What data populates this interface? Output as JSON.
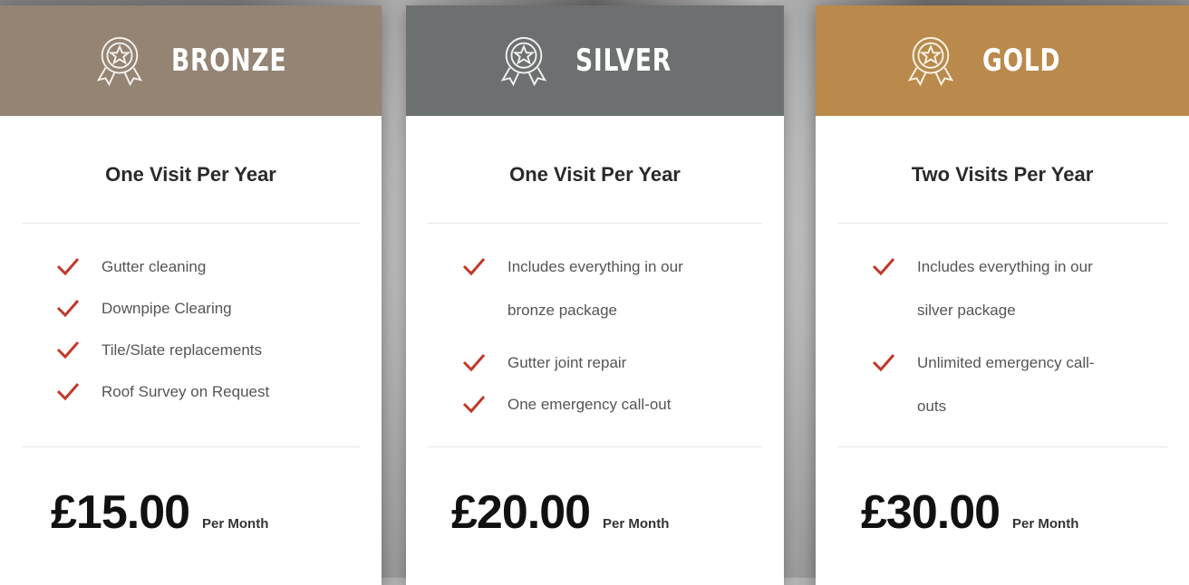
{
  "colors": {
    "bronze": "#948474",
    "silver": "#6d7071",
    "gold": "#b98a4c",
    "check": "#c0392b"
  },
  "plans": [
    {
      "tier": "BRONZE",
      "visits": "One Visit Per Year",
      "features": [
        "Gutter cleaning",
        "Downpipe Clearing",
        "Tile/Slate replacements",
        "Roof Survey on Request"
      ],
      "price": "£15.00",
      "period": "Per Month"
    },
    {
      "tier": "SILVER",
      "visits": "One Visit Per Year",
      "features": [
        "Includes everything in our bronze package",
        "Gutter joint repair",
        "One emergency call-out"
      ],
      "price": "£20.00",
      "period": "Per Month"
    },
    {
      "tier": "GOLD",
      "visits": "Two Visits Per Year",
      "features": [
        "Includes everything in our silver package",
        "Unlimited emergency call-outs"
      ],
      "price": "£30.00",
      "period": "Per Month"
    }
  ]
}
